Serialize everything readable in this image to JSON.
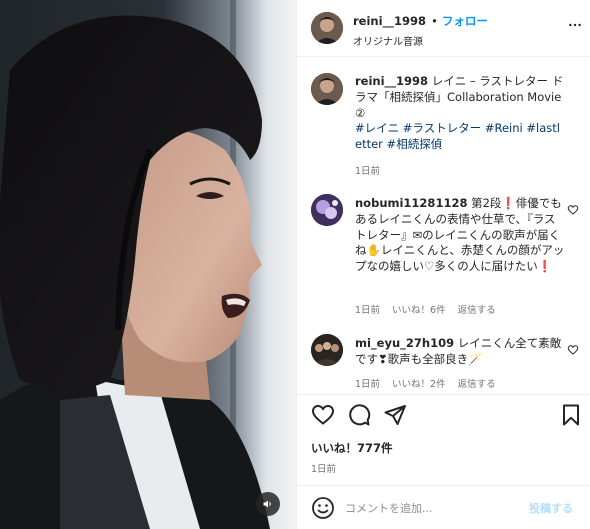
{
  "post": {
    "username": "reini__1998",
    "follow_label": "フォロー",
    "audio_label": "オリジナル音源",
    "caption_username": "reini__1998",
    "caption_text": "レイニ – ラストレター ドラマ「相続探偵」Collaboration Movie②",
    "caption_hashtags": "#レイニ #ラストレター #Reini #lastletter #相続探偵",
    "caption_time": "1日前",
    "likes_label": "いいね！777件",
    "posted_time": "1日前"
  },
  "comments": [
    {
      "username": "nobumi11281128",
      "text": "第2段❗俳優でもあるレイニくんの表情や仕草で、『ラストレター』✉のレイニくんの歌声が届くね✋レイニくんと、赤楚くんの顔がアップなの嬉しい♡多くの人に届けたい❗",
      "time": "1日前",
      "likes": "いいね！6件",
      "reply": "返信する"
    },
    {
      "username": "mi_eyu_27h109",
      "text": "レイニくん全て素敵です❣歌声も全部良き🪄",
      "time": "1日前",
      "likes": "いいね！2件",
      "reply": "返信する"
    }
  ],
  "composer": {
    "placeholder": "コメントを追加...",
    "post_label": "投稿する"
  },
  "icons": {
    "like": "heart-icon",
    "comment": "comment-icon",
    "share": "send-icon",
    "save": "bookmark-icon",
    "more": "more-icon",
    "emoji": "emoji-icon",
    "sound": "volume-icon"
  },
  "colors": {
    "link": "#0095f6",
    "hashtag": "#00376b",
    "secondary_text": "#737373",
    "post_disabled": "#b2dffc"
  }
}
